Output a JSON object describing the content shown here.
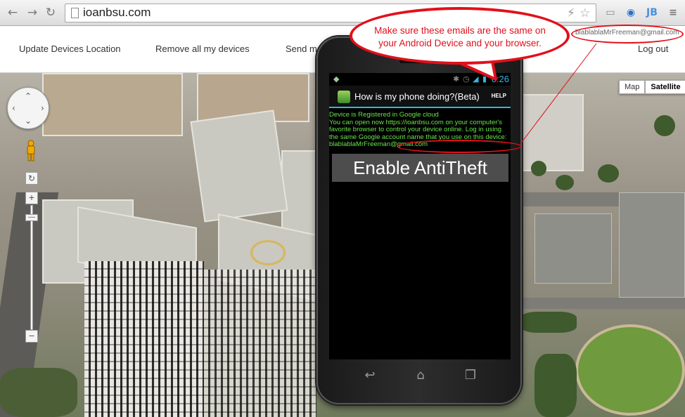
{
  "browser": {
    "url": "ioanbsu.com",
    "icons": {
      "back": "back-arrow-icon",
      "forward": "forward-arrow-icon",
      "reload": "reload-icon",
      "bookmark": "star-icon",
      "menu": "hamburger-menu-icon"
    },
    "extension_jb": "JB"
  },
  "site_nav": {
    "links": [
      "Update Devices Location",
      "Remove all my devices",
      "Send me",
      "Log out"
    ],
    "account_email": "blablablaMrFreeman@gmail.com"
  },
  "map": {
    "maptype": {
      "map_label": "Map",
      "satellite_label": "Satellite",
      "selected": "Satellite"
    },
    "zoom_in_label": "+",
    "zoom_out_label": "−"
  },
  "phone": {
    "time": "0:26",
    "app_title": "How is my phone doing?(Beta)",
    "help_label": "HELP",
    "status_line1": "Device is Registered in Google cloud",
    "status_line2": "You can open now https://ioanbsu.com on your computer's favorite browser to control your device online. Log in using the same Google account name that you use on this device: ",
    "device_email": "blablablaMrFreeman@gmail.com",
    "enable_button": "Enable AntiTheft"
  },
  "callout": {
    "text": "Make sure  these emails are the same on your Android Device and your browser.",
    "color": "#e1101b"
  },
  "colors": {
    "holo_blue": "#33b5e5",
    "status_green": "#66e64a"
  }
}
